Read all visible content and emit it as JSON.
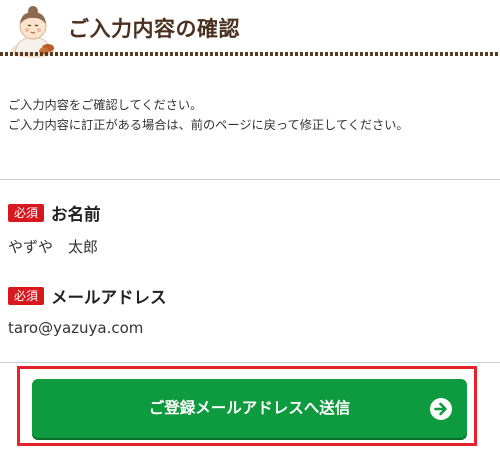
{
  "header": {
    "title": "ご入力内容の確認",
    "mascot_icon": "mascot-icon"
  },
  "intro": {
    "line1": "ご入力内容をご確認してください。",
    "line2": "ご入力内容に訂正がある場合は、前のページに戻って修正してください。"
  },
  "fields": [
    {
      "badge": "必須",
      "label": "お名前",
      "value": "やずや　太郎"
    },
    {
      "badge": "必須",
      "label": "メールアドレス",
      "value": "taro@yazuya.com"
    }
  ],
  "submit": {
    "label": "ご登録メールアドレスへ送信",
    "icon": "arrow-right-circle-icon"
  },
  "colors": {
    "accent_green": "#0e9a3f",
    "required_red": "#d7191f",
    "highlight_red": "#e3232d",
    "header_brown": "#4a3020"
  }
}
